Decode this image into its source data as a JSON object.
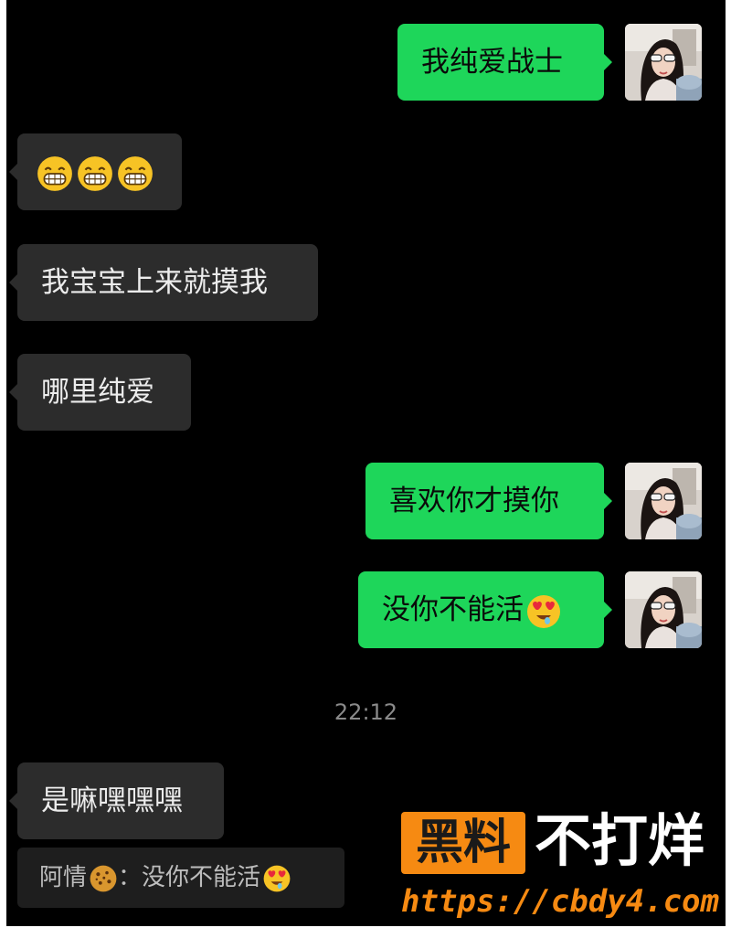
{
  "messages": [
    {
      "from": "me",
      "text": "我纯爱战士"
    },
    {
      "from": "them",
      "emojis": [
        "grin-emoji",
        "grin-emoji",
        "grin-emoji"
      ]
    },
    {
      "from": "them",
      "text": "我宝宝上来就摸我"
    },
    {
      "from": "them",
      "text": "哪里纯爱"
    },
    {
      "from": "me",
      "text": "喜欢你才摸你"
    },
    {
      "from": "me",
      "text": "没你不能活",
      "emoji": "heart-eyes-emoji"
    },
    {
      "from": "them",
      "text": "是嘛嘿嘿嘿"
    }
  ],
  "timestamp": "22:12",
  "quote": {
    "sender": "阿情",
    "separator": "：",
    "text": "没你不能活",
    "sender_emoji": "cookie-emoji",
    "text_emoji": "heart-eyes-emoji"
  },
  "watermark": {
    "badge": "黑料",
    "title": "不打烊",
    "url": "https://cbdy4.com"
  },
  "colors": {
    "background": "#000000",
    "outgoing_bubble": "#1ed65a",
    "incoming_bubble": "#2c2c2c",
    "watermark_accent": "#f68a12"
  }
}
